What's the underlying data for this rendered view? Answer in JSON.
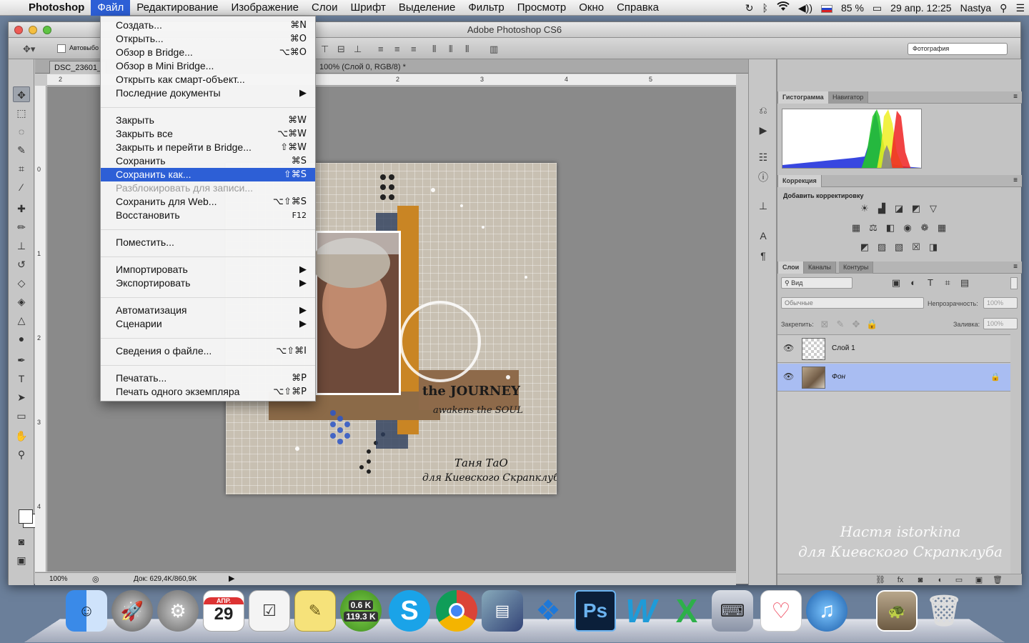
{
  "menubar": {
    "app_name": "Photoshop",
    "items": [
      "Файл",
      "Редактирование",
      "Изображение",
      "Слои",
      "Шрифт",
      "Выделение",
      "Фильтр",
      "Просмотр",
      "Окно",
      "Справка"
    ],
    "status": {
      "battery": "85 %",
      "datetime": "29 апр.  12:25",
      "user": "Nastya"
    }
  },
  "window": {
    "title": "Adobe Photoshop CS6",
    "options": {
      "auto_select": "Автовыбо",
      "workspace": "Фотография"
    },
    "doc_tab_name": "DSC_23601_",
    "doc_tab_info": "100% (Слой 0, RGB/8) *",
    "status": {
      "zoom": "100%",
      "doc_size": "Док: 629,4K/860,9K"
    },
    "ruler_h": [
      "2",
      "2",
      "3",
      "4",
      "5"
    ],
    "ruler_v": [
      "0",
      "1",
      "2",
      "3",
      "4"
    ]
  },
  "file_menu": {
    "items": [
      {
        "label": "Создать...",
        "shortcut": "⌘N"
      },
      {
        "label": "Открыть...",
        "shortcut": "⌘O"
      },
      {
        "label": "Обзор в Bridge...",
        "shortcut": "⌥⌘O"
      },
      {
        "label": "Обзор в Mini Bridge...",
        "shortcut": ""
      },
      {
        "label": "Открыть как смарт-объект...",
        "shortcut": ""
      },
      {
        "label": "Последние документы",
        "shortcut": "▶"
      },
      {
        "label": "Закрыть",
        "shortcut": "⌘W"
      },
      {
        "label": "Закрыть все",
        "shortcut": "⌥⌘W"
      },
      {
        "label": "Закрыть и перейти в Bridge...",
        "shortcut": "⇧⌘W"
      },
      {
        "label": "Сохранить",
        "shortcut": "⌘S"
      },
      {
        "label": "Сохранить как...",
        "shortcut": "⇧⌘S"
      },
      {
        "label": "Разблокировать для записи...",
        "shortcut": ""
      },
      {
        "label": "Сохранить для Web...",
        "shortcut": "⌥⇧⌘S"
      },
      {
        "label": "Восстановить",
        "shortcut": "F12"
      },
      {
        "label": "Поместить...",
        "shortcut": ""
      },
      {
        "label": "Импортировать",
        "shortcut": "▶"
      },
      {
        "label": "Экспортировать",
        "shortcut": "▶"
      },
      {
        "label": "Автоматизация",
        "shortcut": "▶"
      },
      {
        "label": "Сценарии",
        "shortcut": "▶"
      },
      {
        "label": "Сведения о файле...",
        "shortcut": "⌥⇧⌘I"
      },
      {
        "label": "Печатать...",
        "shortcut": "⌘P"
      },
      {
        "label": "Печать одного экземпляра",
        "shortcut": "⌥⇧⌘P"
      }
    ]
  },
  "panels": {
    "histogram_tab": "Гистограмма",
    "navigator_tab": "Навигатор",
    "correction_tab": "Коррекция",
    "correction_label": "Добавить корректировку",
    "layers_tab": "Слои",
    "channels_tab": "Каналы",
    "paths_tab": "Контуры",
    "filter_kind": "Вид",
    "blend_mode": "Обычные",
    "opacity_label": "Непрозрачность:",
    "opacity_value": "100%",
    "lock_label": "Закрепить:",
    "fill_label": "Заливка:",
    "fill_value": "100%",
    "layers": [
      {
        "name": "Слой 1"
      },
      {
        "name": "Фон"
      }
    ]
  },
  "artwork": {
    "caption_1": "the JOURNEY",
    "caption_2": "awakens the SOUL",
    "signature_1": "Таня ТаО",
    "signature_2": "для Киевского Скрапклуба"
  },
  "watermark": {
    "line1": "Настя istorkina",
    "line2": "для Киевского Скрапклуба"
  },
  "dock": {
    "calendar_month": "АПР.",
    "calendar_day": "29",
    "net_up": "0.6 K",
    "net_down": "119.3 K",
    "ps_label": "Ps",
    "word_label": "W",
    "excel_label": "X"
  },
  "colors": {
    "menu_highlight": "#2d5fd6",
    "layer_selected": "#a9bdf2"
  }
}
